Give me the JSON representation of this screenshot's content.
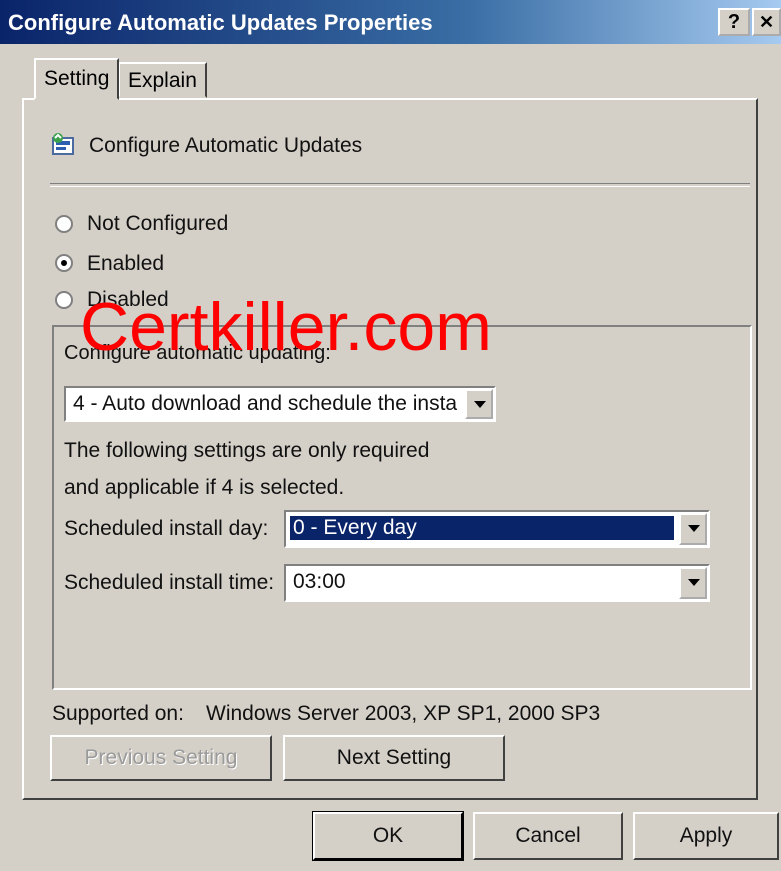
{
  "window": {
    "title": "Configure Automatic Updates Properties",
    "help_button": "?",
    "close_button": "X"
  },
  "tabs": [
    {
      "label": "Setting",
      "active": true
    },
    {
      "label": "Explain",
      "active": false
    }
  ],
  "setting": {
    "policy_name": "Configure Automatic Updates",
    "policy_icon": "policy-icon",
    "radios": [
      {
        "label": "Not Configured",
        "checked": false
      },
      {
        "label": "Enabled",
        "checked": true
      },
      {
        "label": "Disabled",
        "checked": false
      }
    ],
    "group": {
      "label": "Configure automatic updating:",
      "mode_select_value": "4 - Auto download and schedule the insta",
      "note_line1": "The following settings are only required",
      "note_line2": "and applicable if 4 is selected.",
      "install_day_label": "Scheduled install day:",
      "install_day_value": "0 - Every day",
      "install_time_label": "Scheduled install time:",
      "install_time_value": "03:00"
    },
    "supported_label": "Supported on:",
    "supported_value": "Windows Server 2003, XP SP1, 2000 SP3",
    "prev_button": "Previous Setting",
    "next_button": "Next Setting"
  },
  "footer": {
    "ok": "OK",
    "cancel": "Cancel",
    "apply": "Apply"
  },
  "watermark": "Certkiller.com",
  "colors": {
    "title_bar": "#0a246a",
    "selection": "#0a246a",
    "watermark": "#ff0000",
    "dialog_bg": "#d4d0c8"
  }
}
